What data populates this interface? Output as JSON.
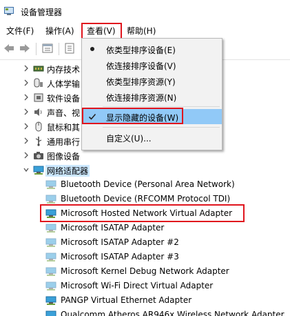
{
  "window": {
    "title": "设备管理器"
  },
  "menubar": {
    "items": [
      {
        "label": "文件(F)"
      },
      {
        "label": "操作(A)"
      },
      {
        "label": "查看(V)"
      },
      {
        "label": "帮助(H)"
      }
    ]
  },
  "view_menu": {
    "items": [
      {
        "label": "依类型排序设备(E)",
        "marker": "bullet"
      },
      {
        "label": "依连接排序设备(V)"
      },
      {
        "label": "依类型排序资源(Y)"
      },
      {
        "label": "依连接排序资源(N)"
      },
      {
        "label": "显示隐藏的设备(W)",
        "marker": "check",
        "highlighted": true
      },
      {
        "label": "自定义(U)..."
      }
    ]
  },
  "tree": {
    "categories_collapsed": [
      {
        "label": "内存技术",
        "icon": "memory-icon"
      },
      {
        "label": "人体学输",
        "icon": "hid-icon"
      },
      {
        "label": "软件设备",
        "icon": "software-device-icon"
      },
      {
        "label": "声音、视",
        "icon": "sound-icon"
      },
      {
        "label": "鼠标和其",
        "icon": "mouse-icon"
      },
      {
        "label": "通用串行",
        "icon": "usb-icon"
      },
      {
        "label": "图像设备",
        "icon": "camera-icon"
      }
    ],
    "network_category": {
      "label": "网络适配器",
      "icon": "network-adapter-icon"
    },
    "adapters": [
      {
        "label": "Bluetooth Device (Personal Area Network)",
        "hidden": true
      },
      {
        "label": "Bluetooth Device (RFCOMM Protocol TDI)",
        "hidden": true
      },
      {
        "label": "Microsoft Hosted Network Virtual Adapter",
        "hidden": false
      },
      {
        "label": "Microsoft ISATAP Adapter",
        "hidden": true
      },
      {
        "label": "Microsoft ISATAP Adapter #2",
        "hidden": true
      },
      {
        "label": "Microsoft ISATAP Adapter #3",
        "hidden": true
      },
      {
        "label": "Microsoft Kernel Debug Network Adapter",
        "hidden": true
      },
      {
        "label": "Microsoft Wi-Fi Direct Virtual Adapter",
        "hidden": true
      },
      {
        "label": "PANGP Virtual Ethernet Adapter",
        "hidden": false
      },
      {
        "label": "Qualcomm Atheros AR946x Wireless Network Adapter",
        "hidden": false
      }
    ]
  },
  "colors": {
    "highlight": "#91c9f7",
    "annotation_red": "#e0141d",
    "selection": "#cce8ff"
  }
}
